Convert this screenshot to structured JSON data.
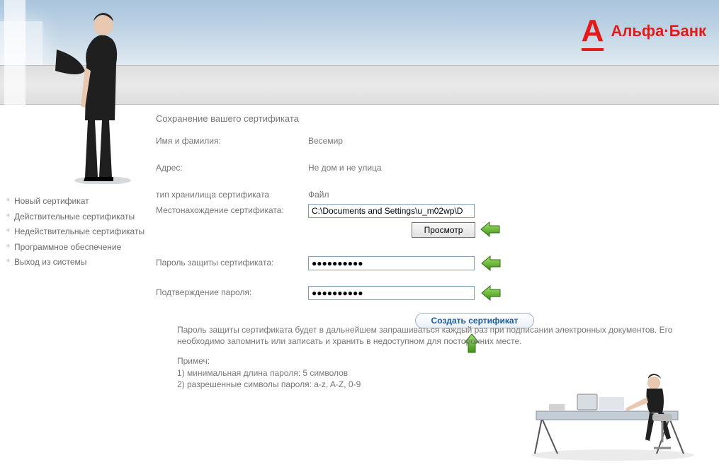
{
  "logo": {
    "alt": "Альфа·Банк"
  },
  "page_title": "Сохранение вашего сертификата",
  "sidebar": {
    "items": [
      {
        "label": "Новый сертификат"
      },
      {
        "label": "Действительные сертификаты"
      },
      {
        "label": "Недействительные сертификаты"
      },
      {
        "label": "Программное обеспечение"
      },
      {
        "label": "Выход из системы"
      }
    ]
  },
  "form": {
    "name_label": "Имя и фамилия:",
    "name_value": "Весемир",
    "address_label": "Адрес:",
    "address_value": "Не дом и не улица",
    "storage_type_label": "тип хранилища сертификата",
    "storage_type_value": "Файл",
    "location_label": "Местонахождение сертификата:",
    "location_value": "C:\\Documents and Settings\\u_m02wp\\D",
    "browse_btn": "Просмотр",
    "password_label": "Пароль защиты сертификата:",
    "password_value": "●●●●●●●●●●",
    "confirm_label": "Подтверждение пароля:",
    "confirm_value": "●●●●●●●●●●",
    "create_btn": "Создать сертификат"
  },
  "note": {
    "p1": "Пароль защиты сертификата будет в дальнейшем запрашиваться каждый раз при подписании электронных документов. Его необходимо запомнить или записать и хранить в недоступном для посторонних месте.",
    "heading": "Примеч:",
    "r1": "1) минимальная длина пароля: 5 символов",
    "r2": "2) разрешенные символы пароля: a-z, A-Z, 0-9"
  }
}
